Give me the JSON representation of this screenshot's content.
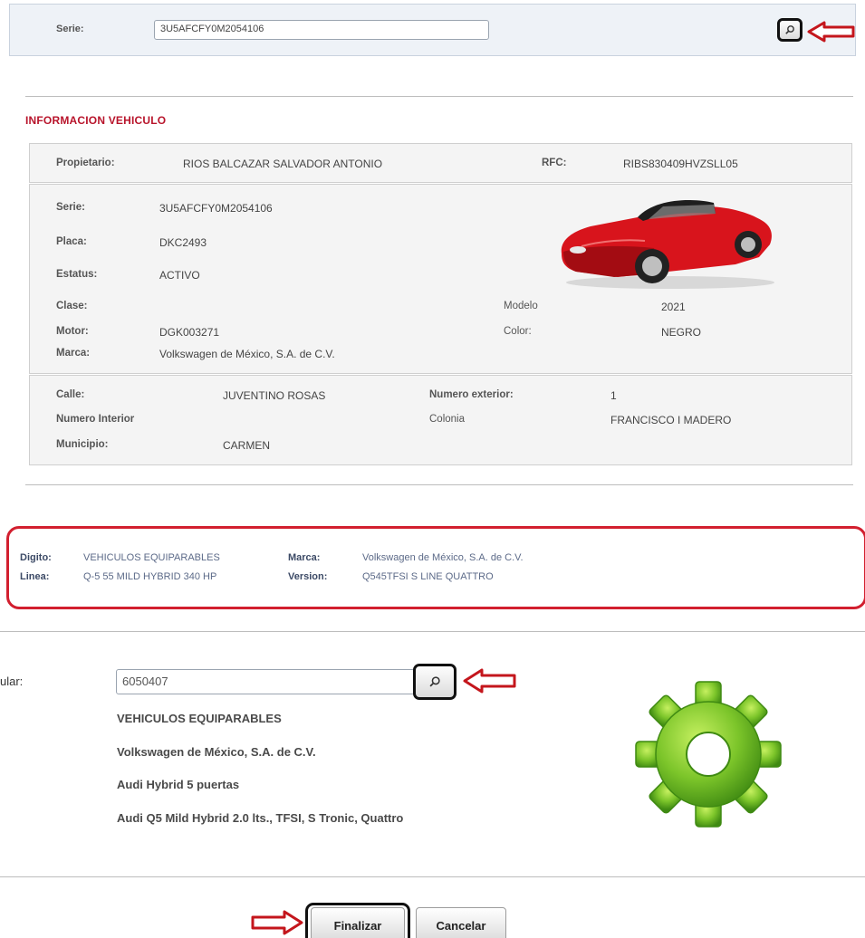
{
  "top_search": {
    "serie_label": "Serie:",
    "serie_value": "3U5AFCFY0M2054106"
  },
  "section_title": "INFORMACION VEHICULO",
  "owner": {
    "propietario_label": "Propietario:",
    "propietario_value": "RIOS BALCAZAR SALVADOR ANTONIO",
    "rfc_label": "RFC:",
    "rfc_value": "RIBS830409HVZSLL05"
  },
  "vehicle": {
    "serie_label": "Serie:",
    "serie_value": "3U5AFCFY0M2054106",
    "placa_label": "Placa:",
    "placa_value": "DKC2493",
    "estatus_label": "Estatus:",
    "estatus_value": "ACTIVO",
    "clase_label": "Clase:",
    "clase_value": "",
    "modelo_label": "Modelo",
    "modelo_value": "2021",
    "motor_label": "Motor:",
    "motor_value": "DGK003271",
    "color_label": "Color:",
    "color_value": "NEGRO",
    "marca_label": "Marca:",
    "marca_value": "Volkswagen de México, S.A. de C.V."
  },
  "address": {
    "calle_label": "Calle:",
    "calle_value": "JUVENTINO ROSAS",
    "num_ext_label": "Numero exterior:",
    "num_ext_value": "1",
    "num_int_label": "Numero Interior",
    "num_int_value": "",
    "colonia_label": "Colonia",
    "colonia_value": "FRANCISCO I MADERO",
    "municipio_label": "Municipio:",
    "municipio_value": "CARMEN"
  },
  "equivalence": {
    "digito_label": "Digito:",
    "digito_value": "VEHICULOS EQUIPARABLES",
    "marca_label": "Marca:",
    "marca_value": "Volkswagen de México, S.A. de C.V.",
    "linea_label": "Linea:",
    "linea_value": "Q-5 55 MILD HYBRID 340 HP",
    "version_label": "Version:",
    "version_value": "Q545TFSI S LINE QUATTRO"
  },
  "vehicular": {
    "label": "ular:",
    "input_value": "6050407",
    "tipo": "VEHICULOS EQUIPARABLES",
    "marca": "Volkswagen de México, S.A. de C.V.",
    "linea": "Audi Hybrid 5 puertas",
    "version": "Audi Q5 Mild Hybrid 2.0 lts., TFSI, S Tronic, Quattro"
  },
  "buttons": {
    "finalizar": "Finalizar",
    "cancelar": "Cancelar"
  },
  "colors": {
    "accent_red": "#d21f2f",
    "title_red": "#b8142b",
    "gear_green": "#7cc52a",
    "car_red": "#d8141c"
  },
  "icons": [
    "search-icon",
    "red-arrow-icon",
    "car-image",
    "gear-icon"
  ]
}
